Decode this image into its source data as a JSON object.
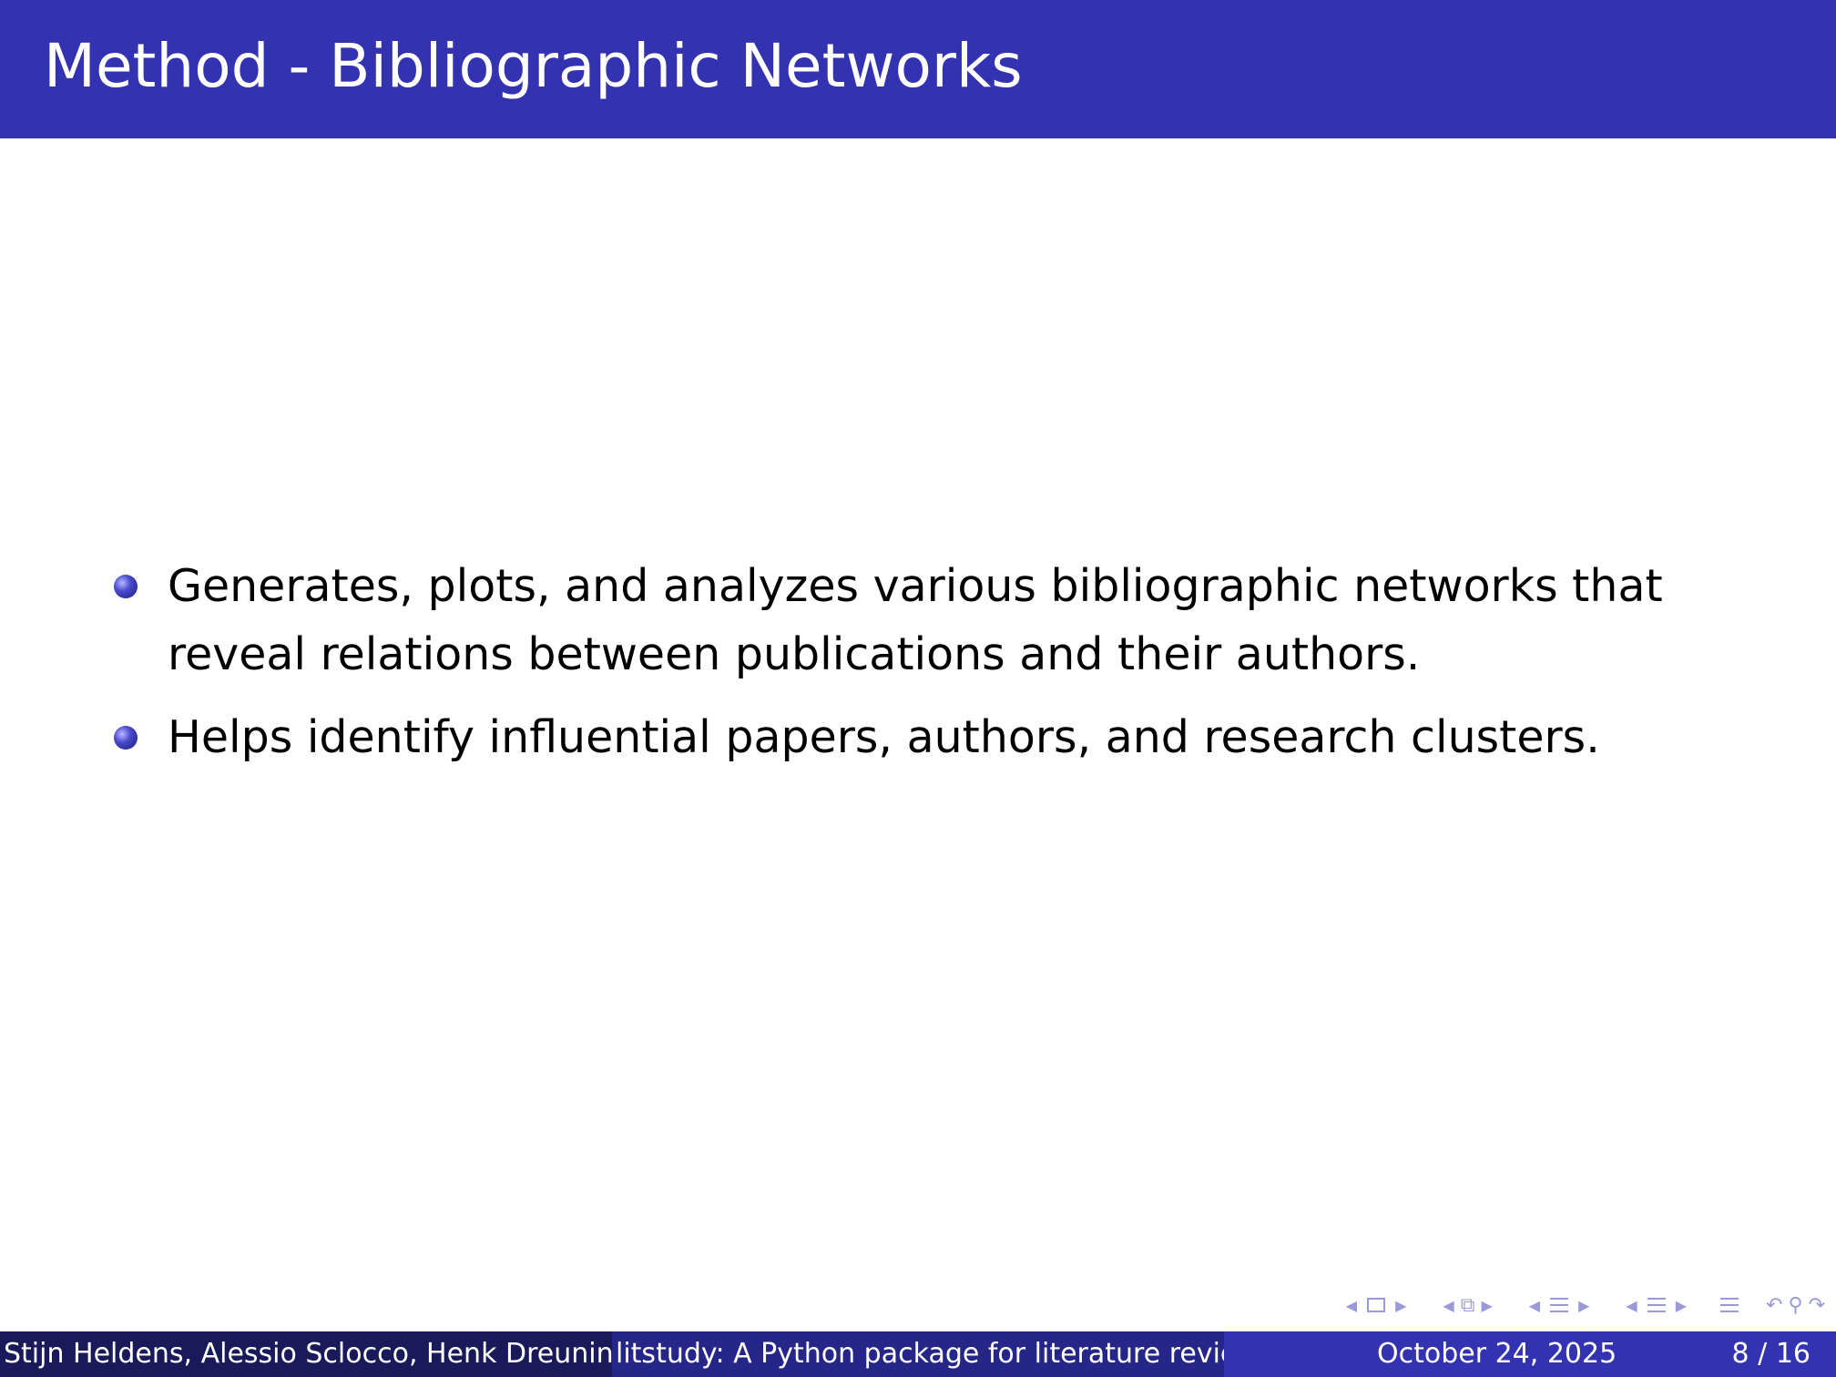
{
  "slide": {
    "title": "Method - Bibliographic Networks",
    "bullets": [
      "Generates, plots, and analyzes various bibliographic networks that reveal relations between publications and their authors.",
      "Helps identify influential papers, authors, and research clusters."
    ]
  },
  "footer": {
    "authors": "Stijn Heldens, Alessio Sclocco, Henk Dreuning",
    "title": "litstudy: A Python package for literature reviews",
    "date": "October 24, 2025",
    "page": "8 / 16"
  },
  "colors": {
    "title_bar": "#3333b2",
    "footer_left": "#1a1a5a",
    "footer_mid": "#262688",
    "footer_right": "#3333b2",
    "nav_icons": "#9a9ad8"
  },
  "nav_icons": [
    "arrow-left-icon",
    "frame-icon",
    "arrow-right-icon",
    "arrow-left-icon",
    "subsection-icon",
    "arrow-right-icon",
    "arrow-left-icon",
    "section-icon",
    "arrow-right-icon",
    "arrow-left-icon",
    "section-icon",
    "arrow-right-icon",
    "outline-icon",
    "search-icon",
    "back-forward-icon"
  ]
}
